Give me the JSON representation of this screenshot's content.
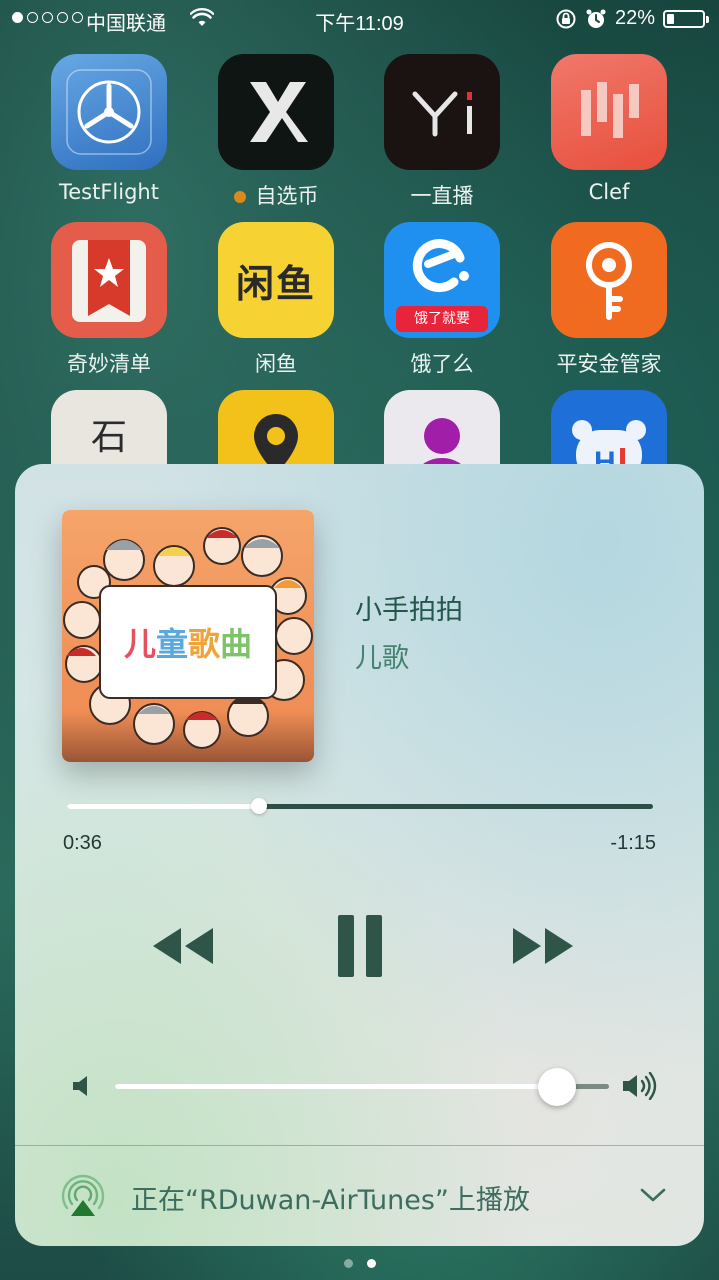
{
  "status_bar": {
    "carrier": "中国联通",
    "time": "下午11:09",
    "battery": "22%",
    "battery_level": 0.22,
    "signal_dots": 5,
    "signal_filled": 1
  },
  "home_apps": [
    {
      "name": "TestFlight"
    },
    {
      "name": "自选币",
      "has_notification_dot": true
    },
    {
      "name": "一直播"
    },
    {
      "name": "Clef"
    },
    {
      "name": "奇妙清单"
    },
    {
      "name": "闲鱼",
      "icon_text": "闲鱼"
    },
    {
      "name": "饿了么",
      "icon_text": "饿了就要"
    },
    {
      "name": "平安金管家"
    },
    {
      "name": "",
      "icon_text": "石"
    },
    {
      "name": ""
    },
    {
      "name": ""
    },
    {
      "name": "",
      "icon_text": "H!"
    }
  ],
  "now_playing": {
    "album_art_text": "儿童歌曲",
    "title": "小手拍拍",
    "artist": "儿歌",
    "elapsed": "0:36",
    "remaining": "-1:15",
    "progress": 0.328,
    "volume": 0.895,
    "airplay_status": "正在“RDuwan-AirTunes”上播放"
  },
  "page_indicator": {
    "count": 2,
    "active": 2
  },
  "colors": {
    "accent": "#2d5a4c",
    "control": "#2f5548",
    "airplay_green": "#1f7a2f"
  }
}
